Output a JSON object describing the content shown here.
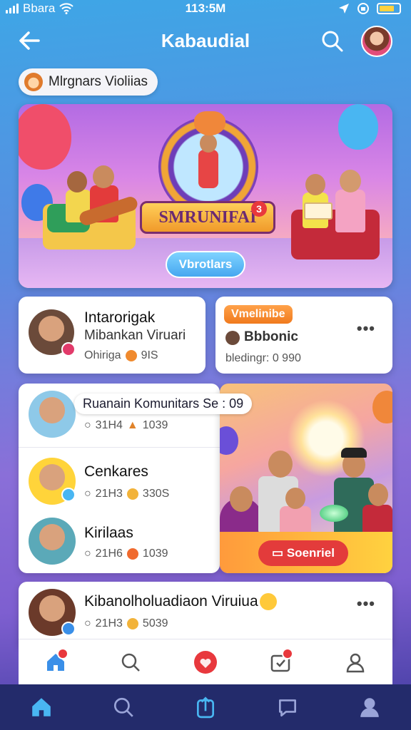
{
  "status": {
    "carrier": "Bbara",
    "time": "113:5M"
  },
  "header": {
    "title": "Kabaudial"
  },
  "chip": {
    "label": "Mlrgnars Violiias"
  },
  "banner": {
    "emblem_text": "SMRUNIFAI",
    "emblem_badge": "3",
    "button_label": "Vbrotlars"
  },
  "card_a": {
    "title": "Intarorigak",
    "subtitle": "Mibankan Viruari",
    "meta_left": "Ohiriga",
    "meta_right": "9IS"
  },
  "card_b": {
    "tag": "Vmelinibe",
    "title": "Bbbonic",
    "meta": "bledingr: 0 990"
  },
  "list_card": {
    "overlay_label": "Ruanain Komunitars Se  : 09",
    "items": [
      {
        "name": "Ruanain Komunitars",
        "stat1": "31H4",
        "stat2": "1039"
      },
      {
        "name": "Cenkares",
        "stat1": "21H3",
        "stat2": "330S"
      },
      {
        "name": "Kirilaas",
        "stat1": "21H6",
        "stat2": "1039"
      }
    ]
  },
  "photo_card": {
    "button_label": "Soenriel"
  },
  "bottom_card": {
    "title": "Kibanolholuadiaon Viruiua",
    "stat1": "21H3",
    "stat2": "5039"
  },
  "tabbar": {
    "top": [
      "home-icon",
      "search-icon",
      "heart-icon",
      "calendar-icon",
      "profile-icon"
    ],
    "bottom": [
      "home-icon",
      "search-icon",
      "upload-icon",
      "chat-icon",
      "profile-icon"
    ]
  },
  "colors": {
    "accent": "#3a8fe8",
    "danger": "#e33b3b",
    "tag": "#f07a1e",
    "nav_dark": "#232b6b"
  }
}
